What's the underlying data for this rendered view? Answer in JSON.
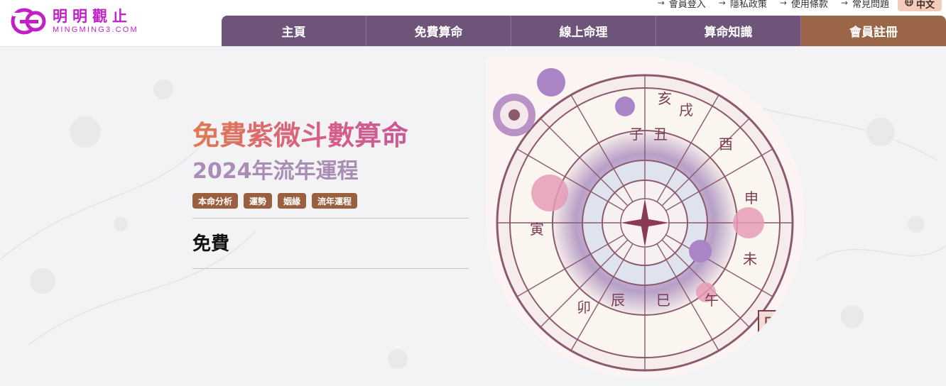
{
  "brand": {
    "name_cn": "明明觀止",
    "name_en": "MINGMING3.COM"
  },
  "top_links": [
    {
      "label": "會員登入"
    },
    {
      "label": "隱私政策"
    },
    {
      "label": "使用條款"
    },
    {
      "label": "常見問題"
    }
  ],
  "language": {
    "label": "中文",
    "icon": "globe-icon"
  },
  "nav": [
    {
      "label": "主頁"
    },
    {
      "label": "免費算命"
    },
    {
      "label": "線上命理"
    },
    {
      "label": "算命知識"
    },
    {
      "label": "會員註冊"
    }
  ],
  "hero": {
    "title": "免費紫微斗數算命",
    "subtitle": "2024年流年運程",
    "tags": [
      "本命分析",
      "運勢",
      "姻緣",
      "流年運程"
    ],
    "price_label": "免費"
  },
  "art": {
    "chart_chars": [
      "亥",
      "戌",
      "酉",
      "申",
      "未",
      "午",
      "巳",
      "辰",
      "卯",
      "寅",
      "丑",
      "子"
    ],
    "seal": "圖"
  },
  "colors": {
    "nav_bg": "#6e5479",
    "nav_accent": "#9a6647",
    "brand": "#c21fc8",
    "tag_bg": "#9a5f3e",
    "subtitle": "#a98db5"
  }
}
